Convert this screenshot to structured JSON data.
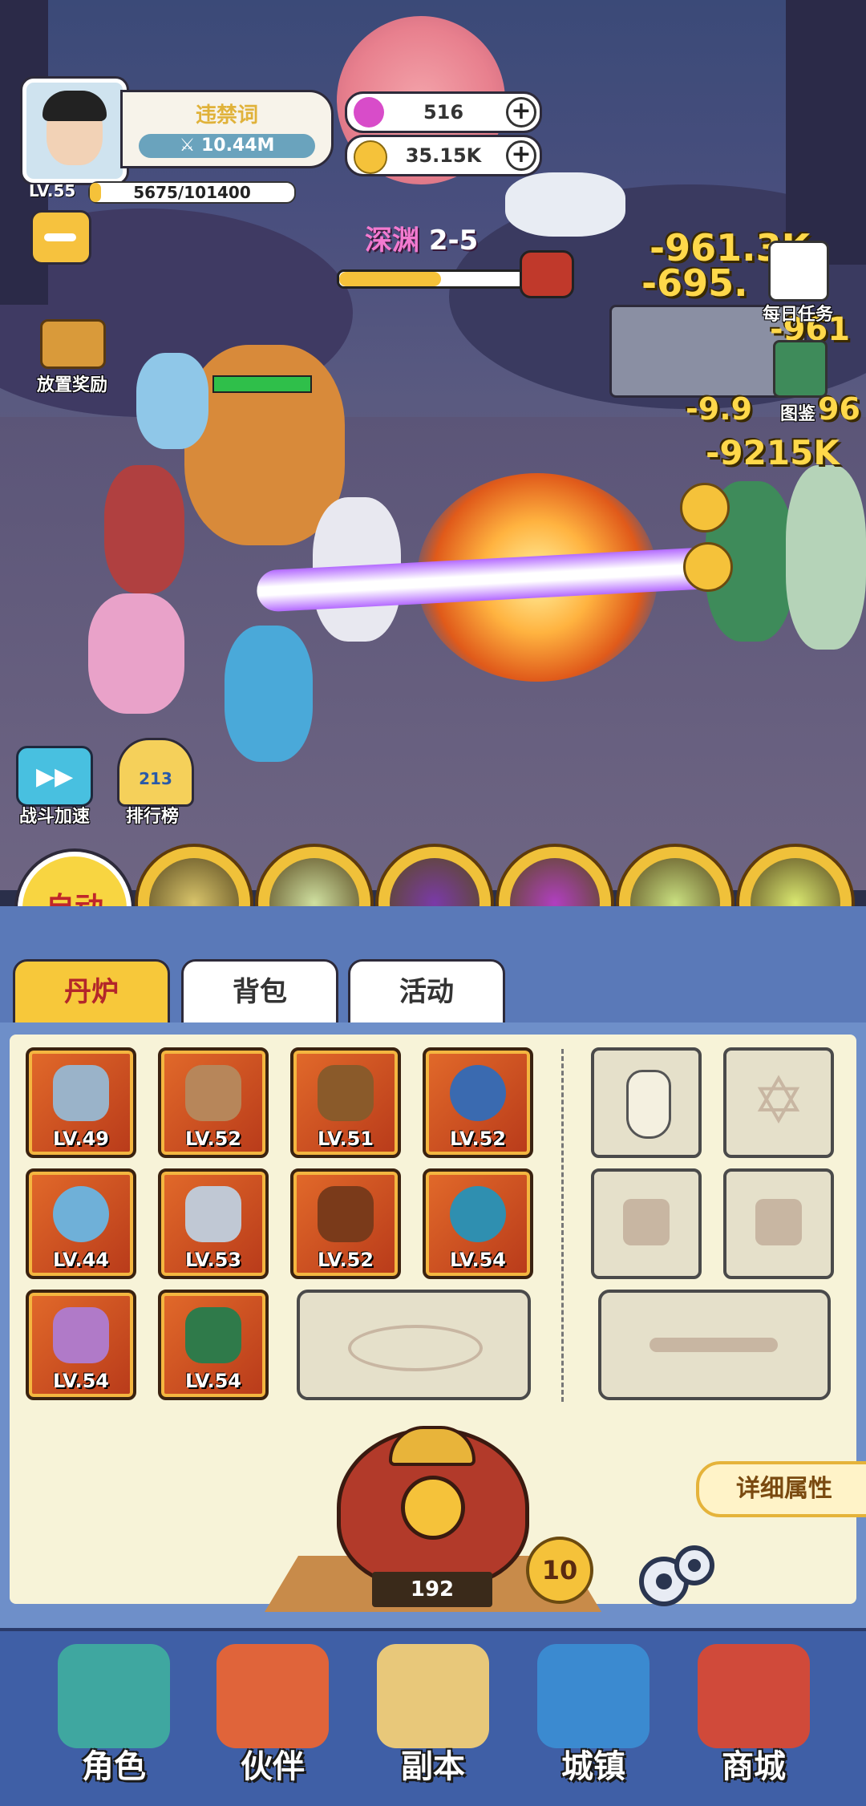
{
  "player": {
    "name": "违禁词",
    "power": "10.44M",
    "level": "LV.55",
    "exp": "5675/101400",
    "exp_fraction": 0.056
  },
  "currency": {
    "diamonds": "516",
    "coins": "35.15K"
  },
  "stage": {
    "zone": "深渊",
    "number": "2-5",
    "progress_fraction": 0.55
  },
  "side_buttons": {
    "idle_reward": "放置奖励",
    "daily_tasks": "每日任务",
    "codex": "图鉴",
    "battle_speed": "战斗加速",
    "ranking": "排行榜",
    "ranking_badge": "213"
  },
  "damage_numbers": [
    "-961.3K",
    "-695.",
    "-961",
    "-9.9",
    "96",
    "-9215K"
  ],
  "skills": {
    "auto_label": "自动",
    "items": [
      {
        "icon": "dragon-icon",
        "color": "#d8c46a"
      },
      {
        "icon": "deer-spirit-icon",
        "color": "#cfe0a0"
      },
      {
        "icon": "purple-orb-icon",
        "color": "#7a3aa8"
      },
      {
        "icon": "vortex-icon",
        "color": "#b03fc0"
      },
      {
        "icon": "rune-scroll-icon",
        "color": "#c9e080"
      },
      {
        "icon": "comet-icon",
        "color": "#d9e870"
      }
    ]
  },
  "tabs": [
    {
      "label": "丹炉",
      "active": true
    },
    {
      "label": "背包",
      "active": false
    },
    {
      "label": "活动",
      "active": false
    }
  ],
  "equipment": [
    {
      "icon": "sword-icon",
      "level": "LV.49"
    },
    {
      "icon": "tower-icon",
      "level": "LV.52"
    },
    {
      "icon": "armor-icon",
      "level": "LV.51"
    },
    {
      "icon": "dragon-orb-icon",
      "level": "LV.52"
    },
    {
      "icon": "ring-icon",
      "level": "LV.44"
    },
    {
      "icon": "shield-icon",
      "level": "LV.53"
    },
    {
      "icon": "crown-icon",
      "level": "LV.52"
    },
    {
      "icon": "pearl-icon",
      "level": "LV.54"
    },
    {
      "icon": "amulet-icon",
      "level": "LV.54"
    },
    {
      "icon": "gauntlet-icon",
      "level": "LV.54"
    }
  ],
  "details_button": "详细属性",
  "furnace": {
    "count": "192",
    "level_badge": "10"
  },
  "nav": [
    {
      "label": "角色",
      "icon": "character-icon"
    },
    {
      "label": "伙伴",
      "icon": "partner-icon"
    },
    {
      "label": "副本",
      "icon": "dungeon-scroll-icon"
    },
    {
      "label": "城镇",
      "icon": "town-icon"
    },
    {
      "label": "商城",
      "icon": "shop-icon"
    }
  ]
}
